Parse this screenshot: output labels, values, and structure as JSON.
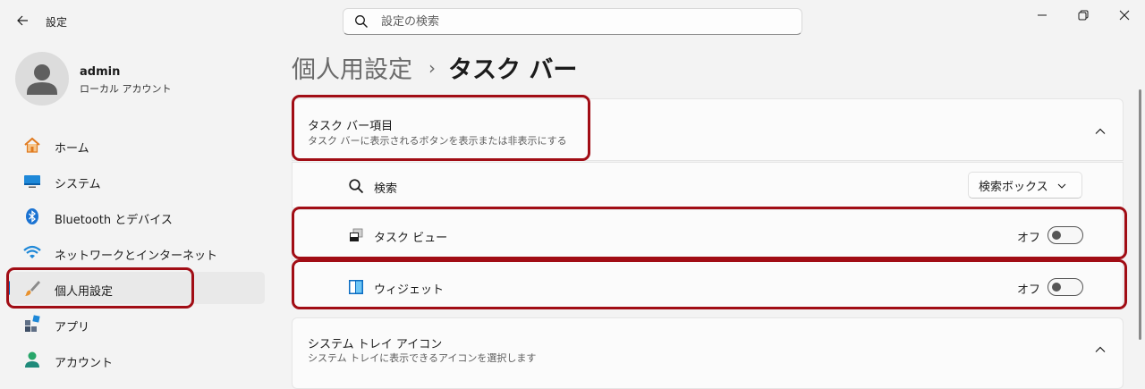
{
  "app": {
    "title": "設定"
  },
  "search": {
    "placeholder": "設定の検索"
  },
  "profile": {
    "name": "admin",
    "account_type": "ローカル アカウント"
  },
  "sidebar": {
    "items": [
      {
        "label": "ホーム",
        "icon": "home-icon"
      },
      {
        "label": "システム",
        "icon": "monitor-icon"
      },
      {
        "label": "Bluetooth とデバイス",
        "icon": "bluetooth-icon"
      },
      {
        "label": "ネットワークとインターネット",
        "icon": "wifi-icon"
      },
      {
        "label": "個人用設定",
        "icon": "paintbrush-icon",
        "selected": true
      },
      {
        "label": "アプリ",
        "icon": "apps-icon"
      },
      {
        "label": "アカウント",
        "icon": "person-icon"
      }
    ]
  },
  "breadcrumb": {
    "parent": "個人用設定",
    "separator": "›",
    "current": "タスク バー"
  },
  "taskbar_items": {
    "title": "タスク バー項目",
    "subtitle": "タスク バーに表示されるボタンを表示または非表示にする",
    "expanded": true,
    "rows": {
      "search": {
        "label": "検索",
        "value": "検索ボックス"
      },
      "task_view": {
        "label": "タスク ビュー",
        "state": "オフ",
        "on": false
      },
      "widgets": {
        "label": "ウィジェット",
        "state": "オフ",
        "on": false
      }
    }
  },
  "system_tray": {
    "title": "システム トレイ アイコン",
    "subtitle": "システム トレイに表示できるアイコンを選択します",
    "expanded": false
  },
  "colors": {
    "accent": "#005fb8",
    "highlight": "#a10d15",
    "background": "#f3f3f3",
    "card": "#fbfbfb"
  }
}
